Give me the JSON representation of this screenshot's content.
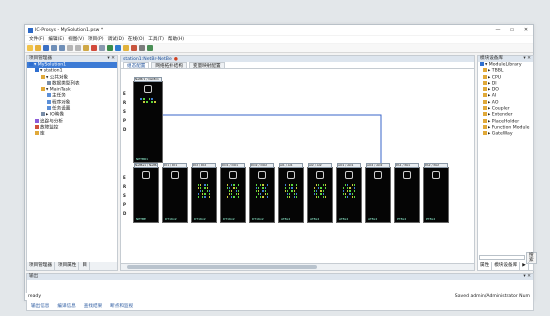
{
  "app": {
    "title": "IC-Prosys - MySolution1.psw *",
    "window_controls": [
      "—",
      "▭",
      "✕"
    ]
  },
  "menu": [
    "文件(F)",
    "编辑(E)",
    "视图(V)",
    "项目(P)",
    "调试(D)",
    "在线(O)",
    "工具(T)",
    "帮助(H)"
  ],
  "toolbar_icons": [
    "new-icon",
    "open-icon",
    "save-icon",
    "undo-icon",
    "redo-icon",
    "cut-icon",
    "copy-icon",
    "paste-icon",
    "delete-icon",
    "find-icon",
    "build-icon",
    "download-icon",
    "run-icon",
    "stop-icon",
    "settings-icon",
    "monitor-icon"
  ],
  "left_panel": {
    "title": "项目管理器",
    "pin": "▾ ✕",
    "tree": [
      {
        "text": "▾ MySolution1",
        "level": 0,
        "selected": true
      },
      {
        "text": "▾ station1",
        "level": 1
      },
      {
        "text": "▾ 公共对象",
        "level": 2
      },
      {
        "text": "数据类型列表",
        "level": 3
      },
      {
        "text": "▾ MainTask",
        "level": 2
      },
      {
        "text": "主任务",
        "level": 3
      },
      {
        "text": "程序对象",
        "level": 3
      },
      {
        "text": "任务设置",
        "level": 3
      },
      {
        "text": "▸ IO映像",
        "level": 2
      },
      {
        "text": "追踪与分析",
        "level": 1
      },
      {
        "text": "故障监控",
        "level": 1
      },
      {
        "text": "库",
        "level": 1
      }
    ],
    "bottom_tabs": [
      "项目管理器",
      "项目属性",
      "目"
    ]
  },
  "editor": {
    "doc_tab": "station1:NetBr-NetBe",
    "doc_close": "●",
    "sub_tabs": [
      "组态配置",
      "网络拓扑结构",
      "变量映射配置"
    ],
    "top_module_header": "NetBr1 / NetBr1",
    "top_module_label": "NETBR1",
    "cpu_rows": [
      "E",
      "R",
      "S",
      "P",
      "D"
    ],
    "bottom_modules": [
      {
        "header": "NetBe1 / NetBe1",
        "label": "NETBE"
      },
      {
        "header": "DI1 / DI1",
        "label": "DT16x2"
      },
      {
        "header": "DI2 / DI2",
        "label": "DT16x2"
      },
      {
        "header": "DO1 / DO1",
        "label": "DT16x2"
      },
      {
        "header": "DO2 / DO2",
        "label": "DT16x2"
      },
      {
        "header": "AI1 / AI1",
        "label": "AT8x2"
      },
      {
        "header": "AI2 / AI2",
        "label": "AT8x2"
      },
      {
        "header": "AO1 / AO1",
        "label": "AT8x2"
      },
      {
        "header": "AO2 / AO2",
        "label": "AT8x2"
      },
      {
        "header": "PA1 / PA1",
        "label": "PT8x2"
      },
      {
        "header": "PA2 / PA2",
        "label": "PT8x2"
      }
    ],
    "led_colors": [
      "#59d63d",
      "#3e7fd0",
      "#59d63d",
      "#c8c83a"
    ]
  },
  "right_panel": {
    "title": "模块设备库",
    "pin": "▾ ✕",
    "tree": [
      "▾ ModuleLibrary",
      "▸ TBBL",
      "▸ CPU",
      "▸ DI",
      "▸ DO",
      "▸ AI",
      "▸ AO",
      "▸ Coupler",
      "▸ Extender",
      "▸ PlaceHolder",
      "▸ Function Module",
      "▸ GateWay"
    ],
    "search_button": "搜索",
    "bottom_tabs": [
      "属性",
      "模块设备库",
      "▶"
    ]
  },
  "output": {
    "title": "输出",
    "pin": "▾ ✕",
    "tabs": [
      "输出信息",
      "编译信息",
      "查找结果",
      "断点和监视"
    ]
  },
  "status": {
    "left": "ready",
    "right": "Saved admin/Administrator Num"
  }
}
